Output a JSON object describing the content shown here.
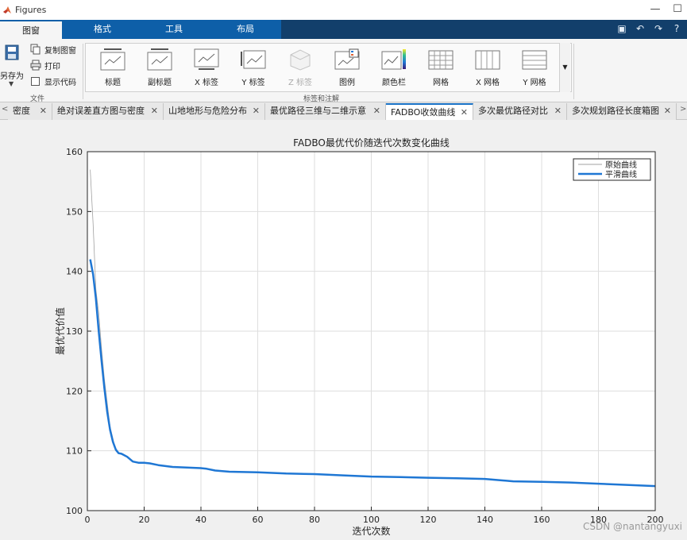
{
  "window": {
    "title": "Figures"
  },
  "ribbon_tabs": [
    {
      "label": "图窗",
      "active": true
    },
    {
      "label": "格式",
      "active": false
    },
    {
      "label": "工具",
      "active": false
    },
    {
      "label": "布局",
      "active": false
    }
  ],
  "file_group": {
    "save_as": "另存为",
    "copy_figure": "复制图窗",
    "print": "打印",
    "show_code": "显示代码",
    "label": "文件"
  },
  "gallery": {
    "items": [
      {
        "label": "标题",
        "icon": "title-icon",
        "enabled": true
      },
      {
        "label": "副标题",
        "icon": "subtitle-icon",
        "enabled": true
      },
      {
        "label": "X 标签",
        "icon": "xlabel-icon",
        "enabled": true
      },
      {
        "label": "Y 标签",
        "icon": "ylabel-icon",
        "enabled": true
      },
      {
        "label": "Z 标签",
        "icon": "zlabel-icon",
        "enabled": false
      },
      {
        "label": "图例",
        "icon": "legend-icon",
        "enabled": true
      },
      {
        "label": "颜色栏",
        "icon": "colorbar-icon",
        "enabled": true
      },
      {
        "label": "网格",
        "icon": "grid-icon",
        "enabled": true
      },
      {
        "label": "X 网格",
        "icon": "xgrid-icon",
        "enabled": true
      },
      {
        "label": "Y 网格",
        "icon": "ygrid-icon",
        "enabled": true
      }
    ],
    "group_label": "标签和注解"
  },
  "doc_tabs": [
    {
      "label": "密度",
      "active": false
    },
    {
      "label": "绝对误差直方图与密度",
      "active": false
    },
    {
      "label": "山地地形与危险分布",
      "active": false
    },
    {
      "label": "最优路径三维与二维示意",
      "active": false
    },
    {
      "label": "FADBO收敛曲线",
      "active": true
    },
    {
      "label": "多次最优路径对比",
      "active": false
    },
    {
      "label": "多次规划路径长度箱图",
      "active": false
    }
  ],
  "colors": {
    "ribbon_blue": "#0e5fa8",
    "smooth_line": "#1f77d4",
    "raw_line": "#a0a0a0"
  },
  "chart_data": {
    "type": "line",
    "title": "FADBO最优代价随迭代次数变化曲线",
    "xlabel": "迭代次数",
    "ylabel": "最优代价值",
    "xlim": [
      0,
      200
    ],
    "ylim": [
      100,
      160
    ],
    "xticks": [
      0,
      20,
      40,
      60,
      80,
      100,
      120,
      140,
      160,
      180,
      200
    ],
    "yticks": [
      100,
      110,
      120,
      130,
      140,
      150,
      160
    ],
    "grid": true,
    "legend_position": "top-right",
    "series": [
      {
        "name": "原始曲线",
        "color": "#a0a0a0",
        "x": [
          1,
          2,
          3,
          4,
          5,
          6,
          7,
          8,
          9,
          10,
          11,
          12,
          14,
          16,
          18,
          20,
          22,
          25,
          30,
          35,
          40,
          42,
          45,
          50,
          60,
          70,
          80,
          90,
          100,
          110,
          120,
          130,
          140,
          145,
          150,
          160,
          170,
          180,
          190,
          200
        ],
        "y": [
          157,
          148,
          137,
          133,
          127,
          122,
          118,
          114,
          112,
          110,
          109.5,
          109.5,
          109,
          108.2,
          108.0,
          108.0,
          107.9,
          107.6,
          107.3,
          107.2,
          107.1,
          107.0,
          106.7,
          106.5,
          106.4,
          106.2,
          106.1,
          105.9,
          105.7,
          105.6,
          105.5,
          105.4,
          105.3,
          105.1,
          104.9,
          104.8,
          104.7,
          104.5,
          104.3,
          104.1
        ]
      },
      {
        "name": "平滑曲线",
        "color": "#1f77d4",
        "x": [
          1,
          2,
          3,
          4,
          5,
          6,
          7,
          8,
          9,
          10,
          11,
          12,
          14,
          16,
          18,
          20,
          22,
          25,
          30,
          35,
          40,
          42,
          45,
          50,
          60,
          70,
          80,
          90,
          100,
          110,
          120,
          130,
          140,
          145,
          150,
          160,
          170,
          180,
          190,
          200
        ],
        "y": [
          142,
          139.5,
          135.5,
          130,
          125,
          120.5,
          116.5,
          113.5,
          111.5,
          110.2,
          109.6,
          109.5,
          109.0,
          108.2,
          108.0,
          108.0,
          107.9,
          107.6,
          107.3,
          107.2,
          107.1,
          107.0,
          106.7,
          106.5,
          106.4,
          106.2,
          106.1,
          105.9,
          105.7,
          105.6,
          105.5,
          105.4,
          105.3,
          105.1,
          104.9,
          104.8,
          104.7,
          104.5,
          104.3,
          104.1
        ]
      }
    ]
  },
  "watermark": "CSDN @nantangyuxi"
}
